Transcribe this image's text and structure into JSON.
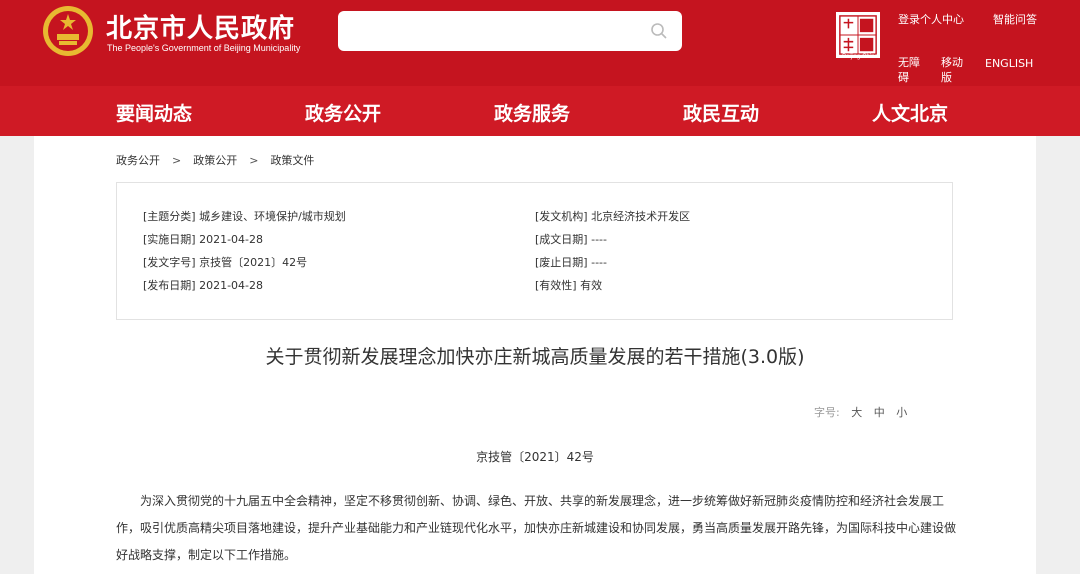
{
  "header": {
    "site_title": "北京市人民政府",
    "site_subtitle": "The People's Government of Beijing Municipality",
    "seal_caption": "Beijing·China",
    "links": {
      "login": "登录个人中心",
      "smart_qa": "智能问答",
      "accessible": "无障碍",
      "mobile": "移动版",
      "english": "ENGLISH"
    },
    "brand_color": "#c5141f"
  },
  "nav": {
    "items": [
      "要闻动态",
      "政务公开",
      "政务服务",
      "政民互动",
      "人文北京"
    ]
  },
  "breadcrumb": [
    "政务公开",
    "政策公开",
    "政策文件"
  ],
  "info": {
    "topic_label": "[主题分类]",
    "topic": "城乡建设、环境保护/城市规划",
    "issuer_label": "[发文机构]",
    "issuer": "北京经济技术开发区",
    "effective_label": "[实施日期]",
    "effective": "2021-04-28",
    "drafted_label": "[成文日期]",
    "drafted": "----",
    "number_label": "[发文字号]",
    "number": "京技管〔2021〕42号",
    "abolish_label": "[废止日期]",
    "abolish": "----",
    "published_label": "[发布日期]",
    "published": "2021-04-28",
    "validity_label": "[有效性]",
    "validity": "有效"
  },
  "doc": {
    "title": "关于贯彻新发展理念加快亦庄新城高质量发展的若干措施(3.0版)",
    "font_size_label": "字号:",
    "font_large": "大",
    "font_medium": "中",
    "font_small": "小",
    "doc_number": "京技管〔2021〕42号",
    "paragraph": "为深入贯彻党的十九届五中全会精神，坚定不移贯彻创新、协调、绿色、开放、共享的新发展理念，进一步统筹做好新冠肺炎疫情防控和经济社会发展工作，吸引优质高精尖项目落地建设，提升产业基础能力和产业链现代化水平，加快亦庄新城建设和协同发展，勇当高质量发展开路先锋，为国际科技中心建设做好战略支撑，制定以下工作措施。"
  }
}
